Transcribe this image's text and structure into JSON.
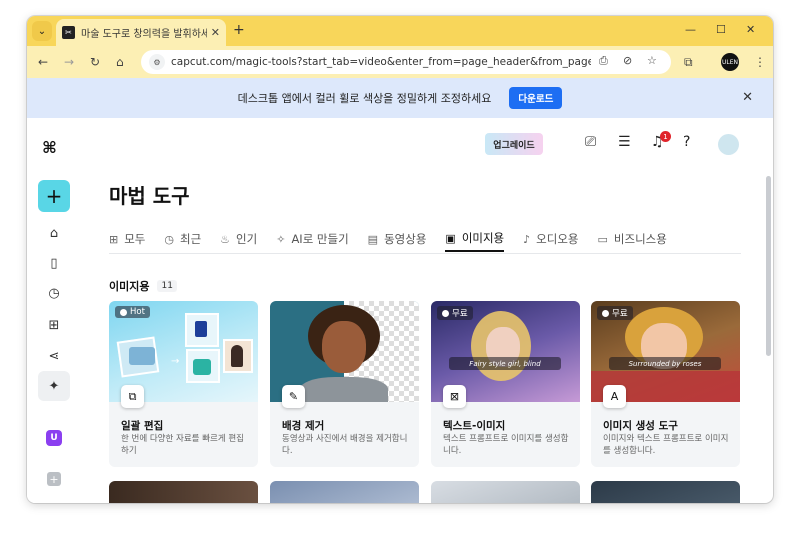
{
  "browser": {
    "tab_title": "마술 도구로 창의력을 발휘하세",
    "url": "capcut.com/magic-tools?start_tab=video&enter_from=page_header&from_page=work_s...",
    "profile_initials": "ULEN"
  },
  "banner": {
    "message": "데스크톱 앱에서 컬러 휠로 색상을 정밀하게 조정하세요",
    "download_label": "다운로드"
  },
  "header": {
    "upgrade_label": "업그레이드",
    "notification_count": "1"
  },
  "page": {
    "title": "마법 도구"
  },
  "tabs": [
    {
      "label": "모두",
      "icon": "grid-icon"
    },
    {
      "label": "최근",
      "icon": "clock-icon"
    },
    {
      "label": "인기",
      "icon": "flame-icon"
    },
    {
      "label": "AI로 만들기",
      "icon": "sparkle-icon"
    },
    {
      "label": "동영상용",
      "icon": "film-icon"
    },
    {
      "label": "이미지용",
      "icon": "image-icon"
    },
    {
      "label": "오디오용",
      "icon": "music-icon"
    },
    {
      "label": "비즈니스용",
      "icon": "ai-box-icon"
    }
  ],
  "active_tab": "이미지용",
  "section": {
    "label": "이미지용",
    "count": "11"
  },
  "cards": [
    {
      "tag": "Hot",
      "title": "일괄 편집",
      "desc": "한 번에 다양한 자료를 빠르게 편집하기",
      "caption": ""
    },
    {
      "tag": "",
      "title": "배경 제거",
      "desc": "동영상과 사진에서 배경을 제거합니다.",
      "caption": ""
    },
    {
      "tag": "무료",
      "title": "텍스트-이미지",
      "desc": "텍스트 프롬프트로 이미지를 생성합니다.",
      "caption": "Fairy style girl, blind"
    },
    {
      "tag": "무료",
      "title": "이미지 생성 도구",
      "desc": "이미지와 텍스트 프롬프트로 이미지를 생성합니다.",
      "caption": "Surrounded by roses"
    }
  ]
}
